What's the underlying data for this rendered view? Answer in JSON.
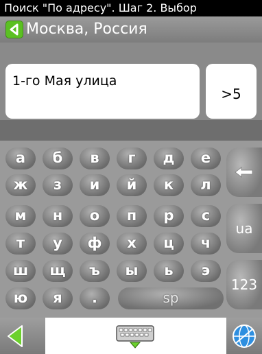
{
  "title": "Поиск \"По адресу\". Шаг 2. Выбор",
  "location": {
    "label": "Москва, Россия",
    "back_icon": "back-arrow-icon",
    "accent": "#5bc022"
  },
  "search": {
    "query": "1-го Мая улица",
    "match_count": ">5"
  },
  "keyboard": {
    "rows": [
      [
        "а",
        "б",
        "в",
        "г",
        "д",
        "е"
      ],
      [
        "ж",
        "з",
        "и",
        "й",
        "к",
        "л"
      ],
      [
        "м",
        "н",
        "о",
        "п",
        "р",
        "с"
      ],
      [
        "т",
        "у",
        "ф",
        "х",
        "ц",
        "ч"
      ],
      [
        "ш",
        "щ",
        "ъ",
        "ы",
        "ь",
        "э"
      ],
      [
        "ю",
        "я",
        "."
      ]
    ],
    "space_label": "sp",
    "backspace_icon": "backspace-arrow-icon",
    "lang_label": "ua",
    "numeric_label": "123"
  },
  "bottombar": {
    "back_icon": "back-triangle-icon",
    "keyboard_icon": "keyboard-icon",
    "globe_icon": "globe-icon"
  }
}
